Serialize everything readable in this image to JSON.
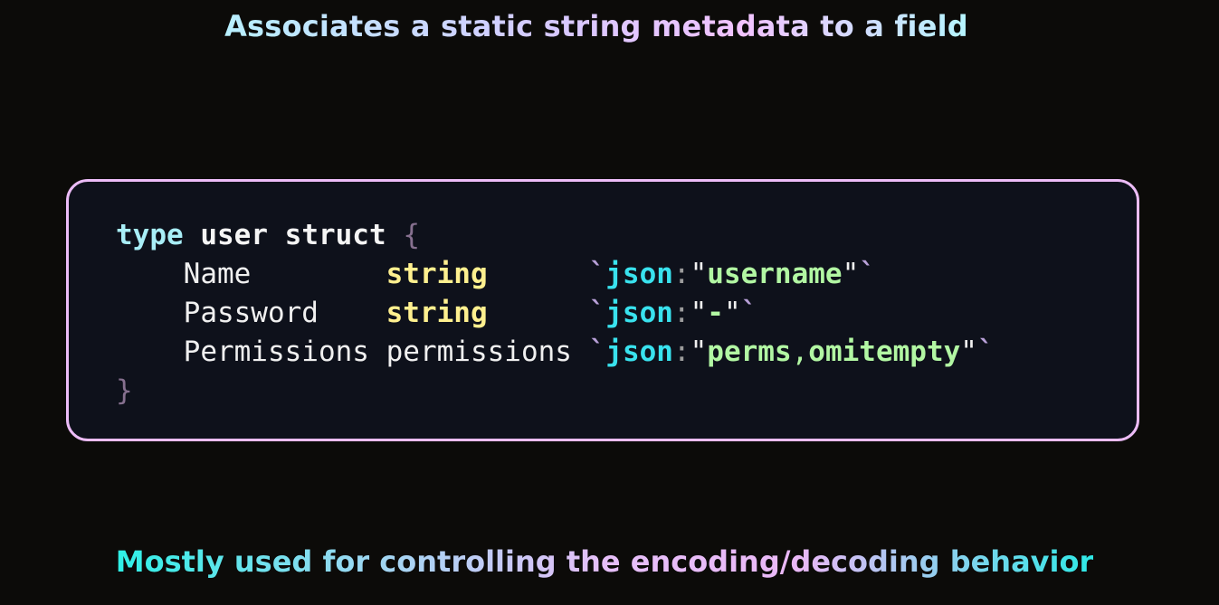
{
  "slide": {
    "title": "Associates a static string metadata to a field",
    "subtitle": "Mostly used for controlling the encoding/decoding behavior"
  },
  "code": {
    "line1": {
      "kw_type": "type",
      "name": "user",
      "kw_struct": "struct",
      "open_brace": "{"
    },
    "fields": [
      {
        "name": "Name",
        "type": "string",
        "tag_key": "json",
        "tag_value": "username"
      },
      {
        "name": "Password",
        "type": "string",
        "tag_key": "json",
        "tag_value": "-"
      },
      {
        "name": "Permissions",
        "type": "permissions",
        "tag_key": "json",
        "tag_value_part1": "perms",
        "tag_value_part2": "omitempty"
      }
    ],
    "close_brace": "}"
  },
  "colors": {
    "background": "#0c0b09",
    "code_background": "#0e111b",
    "code_border": "#ecbcf7",
    "keyword_type": "#a8eef7",
    "type_name": "#fff08f",
    "tag_key": "#39e2ee",
    "tag_value": "#b2f7a3"
  }
}
